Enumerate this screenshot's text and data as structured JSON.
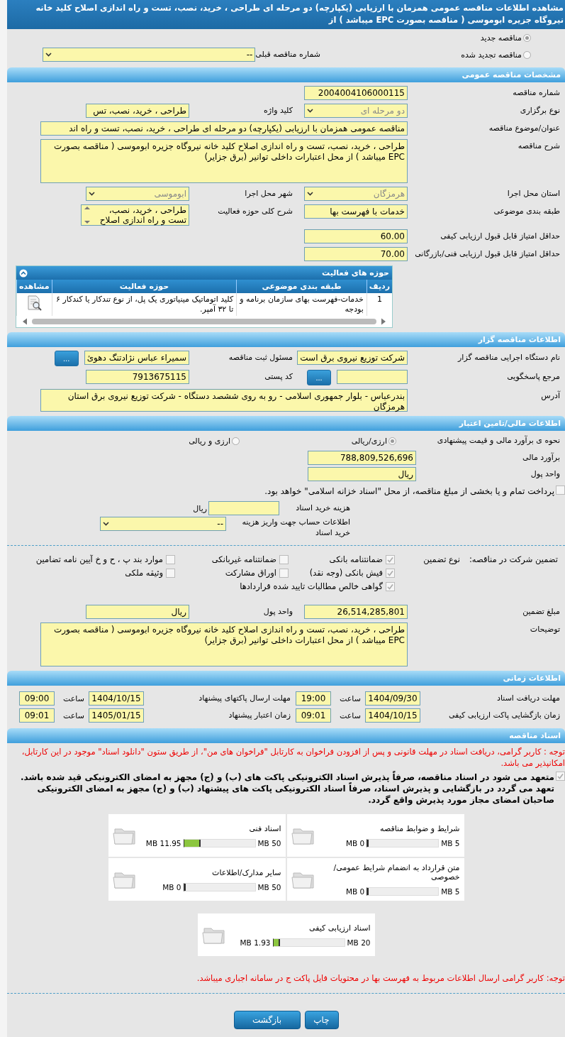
{
  "title": "مشاهده اطلاعات مناقصه عمومی همزمان با ارزیابی (یکپارچه) دو مرحله ای طراحی ، خرید، نصب، تست و راه اندازی اصلاح کلید خانه نیروگاه جزیره ابوموسی ( مناقصه بصورت EPC میباشد ) از",
  "tender_kind": {
    "options": [
      {
        "label": "مناقصه جدید",
        "selected": true
      },
      {
        "label": "مناقصه تجدید شده",
        "selected": false
      }
    ],
    "previous": {
      "label": "شماره مناقصه قبلی",
      "value": "--",
      "kind": "select"
    }
  },
  "general": {
    "heading": "مشخصات مناقصه عمومی",
    "rows": [
      {
        "right": {
          "label": "شماره مناقصه",
          "value": "2004004106000115",
          "kind": "text"
        }
      },
      {
        "right": {
          "label": "نوع برگزاری",
          "value": "دو مرحله ای",
          "kind": "select",
          "disabled": true
        },
        "left": {
          "label": "کلید واژه",
          "value": "طراحی ، خرید،  نصب، تس",
          "kind": "text"
        }
      },
      {
        "right": {
          "label": "عنوان/موضوع مناقصه",
          "value": "مناقصه عمومی همزمان با ارزیابی (یکپارچه) دو مرحله ای طراحی ، خرید،  نصب، تست و راه اند",
          "kind": "text",
          "wide": true
        }
      },
      {
        "right": {
          "label": "شرح مناقصه",
          "value": "طراحی ، خرید،  نصب، تست و راه اندازی اصلاح کلید خانه نیروگاه جزیره ابوموسی ( مناقصه بصورت EPC میباشد ) از محل اعتبارات داخلی توانیر (برق جزایر)",
          "kind": "textarea",
          "wide": true
        }
      },
      {
        "right": {
          "label": "استان محل اجرا",
          "value": "هرمزگان",
          "kind": "select",
          "disabled": true
        },
        "left": {
          "label": "شهر محل اجرا",
          "value": "ابوموسی",
          "kind": "select",
          "disabled": true
        }
      },
      {
        "right": {
          "label": "طبقه بندی موضوعی",
          "value": "خدمات با فهرست بها",
          "kind": "text"
        },
        "left": {
          "label": "شرح کلی حوزه فعالیت",
          "value": "طراحی ، خرید،  نصب، تست و راه اندازی اصلاح",
          "kind": "listbox"
        }
      },
      {
        "right": {
          "label": "حداقل امتیاز قابل قبول ارزیابی کیفی",
          "value": "60.00",
          "kind": "text"
        }
      },
      {
        "right": {
          "label": "حداقل امتیاز قابل قبول ارزیابی فنی/بازرگانی",
          "value": "70.00",
          "kind": "text"
        }
      }
    ],
    "activity_table": {
      "heading": "حوزه های فعالیت",
      "columns": [
        "ردیف",
        "طبقه بندی موضوعی",
        "حوزه فعالیت",
        "مشاهده"
      ],
      "rows": [
        {
          "cells": [
            "1",
            "خدمات-فهرست بهای سازمان برنامه و بودجه",
            "کلید اتوماتیک مینیاتوری یک پل، از نوع تندکار یا کندکار ۶ تا ۳۲ آمپر."
          ]
        }
      ]
    }
  },
  "organizer": {
    "heading": "اطلاعات مناقصه گزار",
    "rows": [
      {
        "right": {
          "label": "نام دستگاه اجرایی مناقصه گزار",
          "value": "شرکت توزیع نیروی برق است",
          "kind": "text"
        },
        "left": {
          "label": "مسئول ثبت مناقصه",
          "value": "سمیراء عباس نژادتنگ دهوئ",
          "kind": "text",
          "button": "..."
        }
      },
      {
        "right": {
          "label": "مرجع پاسخگویی",
          "kind": "text",
          "button": "..."
        },
        "left": {
          "label": "کد پستی",
          "value": "7913675115",
          "kind": "text"
        }
      },
      {
        "right": {
          "label": "آدرس",
          "value": "بندرعباس - بلوار جمهوری اسلامی - رو به روی ششصد دستگاه - شرکت توزیع نیروی برق استان هرمزگان",
          "kind": "textarea",
          "wide": true,
          "short": true
        }
      }
    ]
  },
  "finance": {
    "heading": "اطلاعات مالی/تامین اعتبار",
    "estimate_method": {
      "label": "نحوه ی برآورد مالی و قیمت پیشنهادی",
      "options": [
        {
          "label": "ارزی/ریالی",
          "selected": true
        },
        {
          "label": "ارزی و ریالی",
          "selected": false
        }
      ]
    },
    "estimate": {
      "label": "برآورد مالی",
      "value": "788,809,526,696"
    },
    "currency": {
      "label": "واحد پول",
      "value": "ریال"
    },
    "treasury": {
      "label": "پرداخت تمام و یا بخشی از مبلغ مناقصه، از محل \"اسناد خزانه اسلامی\" خواهد بود.",
      "checked": false
    },
    "doc_fee": {
      "label": "هزینه خرید اسناد",
      "unit": "ریال"
    },
    "account": {
      "label": "اطلاعات حساب جهت واریز هزینه خرید اسناد",
      "value": "--"
    },
    "guarantee": {
      "label": "تضمین شرکت در مناقصه:",
      "type_label": "نوع تضمین",
      "options": [
        {
          "label": "ضمانتنامه بانکی",
          "checked": true
        },
        {
          "label": "ضمانتنامه غیربانکی",
          "checked": false
        },
        {
          "label": "موارد بند پ ، ح و خ آیین نامه تضامین",
          "checked": false
        },
        {
          "label": "فیش بانکی (وجه نقد)",
          "checked": true
        },
        {
          "label": "اوراق مشارکت",
          "checked": false
        },
        {
          "label": "وثیقه ملکی",
          "checked": false
        },
        {
          "label": "گواهی خالص مطالبات تایید شده قراردادها",
          "checked": true
        }
      ]
    },
    "rows": [
      {
        "right": {
          "label": "مبلغ تضمین",
          "value": "26,514,285,801",
          "kind": "text"
        },
        "left": {
          "label": "واحد پول",
          "value": "ریال",
          "kind": "text"
        }
      },
      {
        "right": {
          "label": "توضیحات",
          "value": "طراحی ، خرید،  نصب، تست و راه اندازی اصلاح کلید خانه نیروگاه جزیره ابوموسی ( مناقصه بصورت EPC میباشد ) از محل اعتبارات داخلی توانیر (برق جزایر)",
          "kind": "textarea",
          "wide": true
        }
      }
    ]
  },
  "schedule": {
    "heading": "اطلاعات زمانی",
    "items": [
      {
        "label": "مهلت دریافت اسناد",
        "date": "1404/09/30",
        "time_label": "ساعت",
        "time": "19:00"
      },
      {
        "label": "مهلت ارسال پاکتهای پیشنهاد",
        "date": "1404/10/15",
        "time_label": "ساعت",
        "time": "09:00"
      },
      {
        "label": "زمان بازگشایی پاکت ارزیابی کیفی",
        "date": "1404/10/15",
        "time_label": "ساعت",
        "time": "09:01"
      },
      {
        "label": "زمان اعتبار پیشنهاد",
        "date": "1405/01/15",
        "time_label": "ساعت",
        "time": "09:01"
      }
    ]
  },
  "documents": {
    "heading": "اسناد مناقصه",
    "notice": "توجه : کاربر گرامی، دریافت اسناد در مهلت قانونی و پس از افزودن فراخوان به کارتابل \"فراخوان های من\"، از طریق ستون \"دانلود اسناد\" موجود در این کارتابل، امکانپذیر می باشد.",
    "commitment": {
      "text": "متعهد می شود در اسناد مناقصه، صرفاً پذیرش اسناد الکترونیکی پاکت های (ب) و (ج) مجهز به امضای الکترونیکی قید شده باشد. تعهد می گردد در بازگشایی و پذیرش اسناد، صرفاً اسناد الکترونیکی پاکت های پیشنهاد (ب) و (ج) مجهز به امضای الکترونیکی صاحبان امضای مجاز مورد پذیرش واقع گردد.",
      "checked": true
    },
    "files": [
      {
        "name": "شرایط و ضوابط مناقصه",
        "max": "5 MB",
        "used": "0 MB",
        "level": 0
      },
      {
        "name": "اسناد فنی",
        "max": "50 MB",
        "used": "11.95 MB",
        "level": 0.239
      },
      {
        "name": "متن قرارداد به انضمام شرایط عمومی/خصوصی",
        "max": "5 MB",
        "used": "0 MB",
        "level": 0
      },
      {
        "name": "سایر مدارک/اطلاعات",
        "max": "50 MB",
        "used": "0 MB",
        "level": 0
      },
      {
        "name": "اسناد ارزیابی کیفی",
        "max": "20 MB",
        "used": "1.93 MB",
        "level": 0.0965
      }
    ],
    "footer_note": "توجه: کاربر گرامی ارسال اطلاعات مربوط به فهرست بها در محتویات فایل پاکت ج در سامانه اجباری میباشد."
  },
  "buttons": [
    {
      "label": "چاپ"
    },
    {
      "label": "بازگشت"
    }
  ]
}
